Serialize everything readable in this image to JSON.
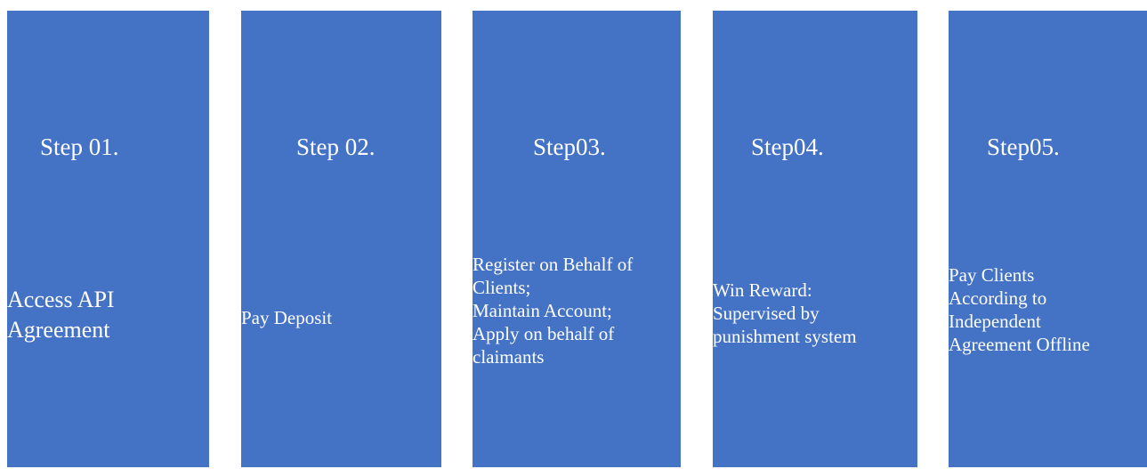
{
  "steps": [
    {
      "title": "Step 01.",
      "description": "Access API\nAgreement"
    },
    {
      "title": "Step 02.",
      "description": "Pay Deposit"
    },
    {
      "title": "Step03.",
      "description": "Register on Behalf of\nClients;\nMaintain Account;\nApply on behalf of\nclaimants"
    },
    {
      "title": "Step04.",
      "description": "Win Reward:\nSupervised by\npunishment system"
    },
    {
      "title": "Step05.",
      "description": "Pay Clients\nAccording to\nIndependent\nAgreement Offline"
    }
  ],
  "colors": {
    "panel": "#4472c4",
    "text": "#ffffff",
    "background": "#ffffff"
  }
}
